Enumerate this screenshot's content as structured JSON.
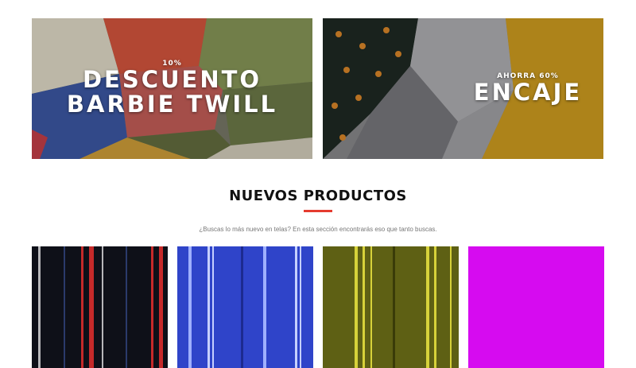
{
  "banners": [
    {
      "small": "10%",
      "title_line1": "DESCUENTO",
      "title_line2": "BARBIE TWILL"
    },
    {
      "small": "AHORRA 60%",
      "title_line1": "ENCAJE"
    }
  ],
  "section": {
    "title": "NUEVOS PRODUCTOS",
    "description": "¿Buscas lo más nuevo en telas? En esta sección encontrarás eso que tanto buscas.",
    "accent_color": "#e53b2f"
  },
  "products": [
    {
      "image": "black-striped-fabric",
      "base_color": "#0e1018"
    },
    {
      "image": "blue-striped-fabric",
      "base_color": "#2f44c9"
    },
    {
      "image": "olive-striped-fabric",
      "base_color": "#5e6014"
    },
    {
      "image": "magenta-fabric",
      "base_color": "#d60bf0"
    }
  ]
}
